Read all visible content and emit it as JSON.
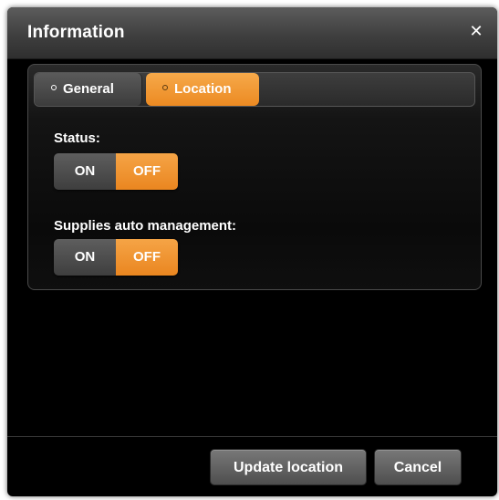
{
  "dialog": {
    "title": "Information",
    "close_glyph": "✕"
  },
  "tabs": [
    {
      "label": "General",
      "active": false
    },
    {
      "label": "Location",
      "active": true
    }
  ],
  "fields": [
    {
      "label": "Status:",
      "on_label": "ON",
      "off_label": "OFF",
      "selected": "OFF"
    },
    {
      "label": "Supplies auto management:",
      "on_label": "ON",
      "off_label": "OFF",
      "selected": "OFF"
    }
  ],
  "footer": {
    "update_label": "Update location",
    "cancel_label": "Cancel"
  },
  "colors": {
    "accent": "#f0952f",
    "background": "#000000",
    "neutral_button": "#5a5a5a"
  }
}
